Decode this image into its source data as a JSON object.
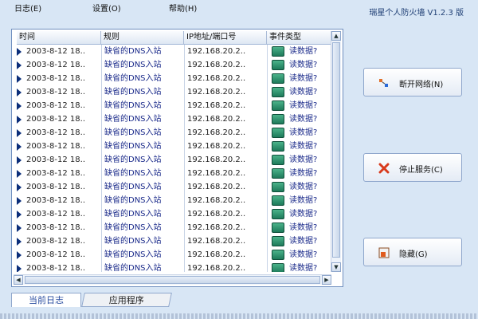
{
  "menu": [
    "日志(E)",
    "设置(O)",
    "帮助(H)"
  ],
  "app_title": "瑞星个人防火墙 V1.2.3 版",
  "columns": [
    "时间",
    "规则",
    "IP地址/端口号",
    "事件类型"
  ],
  "rows": [
    {
      "time": "2003-8-12 18..",
      "rule": "缺省的DNS入站",
      "ip": "192.168.20.2..",
      "event": "读数据?"
    },
    {
      "time": "2003-8-12 18..",
      "rule": "缺省的DNS入站",
      "ip": "192.168.20.2..",
      "event": "读数据?"
    },
    {
      "time": "2003-8-12 18..",
      "rule": "缺省的DNS入站",
      "ip": "192.168.20.2..",
      "event": "读数据?"
    },
    {
      "time": "2003-8-12 18..",
      "rule": "缺省的DNS入站",
      "ip": "192.168.20.2..",
      "event": "读数据?"
    },
    {
      "time": "2003-8-12 18..",
      "rule": "缺省的DNS入站",
      "ip": "192.168.20.2..",
      "event": "读数据?"
    },
    {
      "time": "2003-8-12 18..",
      "rule": "缺省的DNS入站",
      "ip": "192.168.20.2..",
      "event": "读数据?"
    },
    {
      "time": "2003-8-12 18..",
      "rule": "缺省的DNS入站",
      "ip": "192.168.20.2..",
      "event": "读数据?"
    },
    {
      "time": "2003-8-12 18..",
      "rule": "缺省的DNS入站",
      "ip": "192.168.20.2..",
      "event": "读数据?"
    },
    {
      "time": "2003-8-12 18..",
      "rule": "缺省的DNS入站",
      "ip": "192.168.20.2..",
      "event": "读数据?"
    },
    {
      "time": "2003-8-12 18..",
      "rule": "缺省的DNS入站",
      "ip": "192.168.20.2..",
      "event": "读数据?"
    },
    {
      "time": "2003-8-12 18..",
      "rule": "缺省的DNS入站",
      "ip": "192.168.20.2..",
      "event": "读数据?"
    },
    {
      "time": "2003-8-12 18..",
      "rule": "缺省的DNS入站",
      "ip": "192.168.20.2..",
      "event": "读数据?"
    },
    {
      "time": "2003-8-12 18..",
      "rule": "缺省的DNS入站",
      "ip": "192.168.20.2..",
      "event": "读数据?"
    },
    {
      "time": "2003-8-12 18..",
      "rule": "缺省的DNS入站",
      "ip": "192.168.20.2..",
      "event": "读数据?"
    },
    {
      "time": "2003-8-12 18..",
      "rule": "缺省的DNS入站",
      "ip": "192.168.20.2..",
      "event": "读数据?"
    },
    {
      "time": "2003-8-12 18..",
      "rule": "缺省的DNS入站",
      "ip": "192.168.20.2..",
      "event": "读数据?"
    },
    {
      "time": "2003-8-12 18..",
      "rule": "缺省的DNS入站",
      "ip": "192.168.20.2..",
      "event": "读数据?"
    }
  ],
  "tabs": [
    "当前日志",
    "应用程序"
  ],
  "buttons": {
    "disconnect": "断开网络(N)",
    "stop": "停止服务(C)",
    "hide": "隐藏(G)"
  },
  "icons": {
    "row_marker": "arrow-right-icon",
    "event": "network-icon",
    "disconnect": "disconnect-icon",
    "stop": "stop-x-icon",
    "hide": "hide-window-icon"
  },
  "colors": {
    "background": "#d8e6f5",
    "accent": "#2a4da0",
    "stop_red": "#d83a1c"
  }
}
